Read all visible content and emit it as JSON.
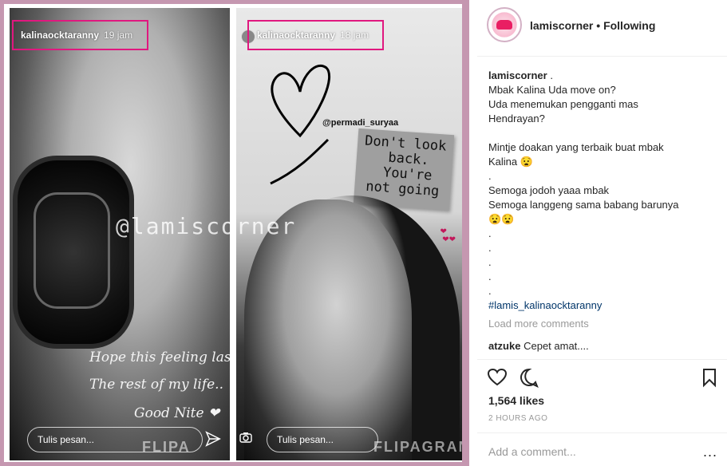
{
  "post": {
    "stories": [
      {
        "username": "kalinaocktaranny",
        "time": "19 jam"
      },
      {
        "username": "kalinaocktaranny",
        "time": "18 jam"
      }
    ],
    "watermark": "@lamiscorner",
    "handwritten_lines": [
      "Hope this feeling lasts",
      "The rest of my life..",
      "Good Nite ❤"
    ],
    "reply_placeholder_left": "Tulis pesan...",
    "reply_placeholder_right": "Tulis pesan...",
    "mention": "@permadi_suryaa",
    "sign_text": "Don't look\n back.\n You're\nnot going",
    "app_watermark_left": "FLIPA",
    "app_watermark_right": "FLIPAGRAN"
  },
  "header": {
    "username": "lamiscorner",
    "separator": "•",
    "follow_state": "Following"
  },
  "caption": {
    "author": "lamiscorner",
    "author_suffix": " .",
    "lines": [
      "Mbak Kalina Uda move on?",
      "Uda menemukan pengganti mas",
      "Hendrayan?",
      "",
      "Mintje doakan yang terbaik buat mbak",
      "Kalina 😧",
      ".",
      "Semoga jodoh yaaa mbak",
      "Semoga langgeng sama babang barunya",
      "😧😧",
      ".",
      ".",
      ".",
      ".",
      "."
    ],
    "hashtag": "#lamis_kalinaocktaranny"
  },
  "comments": {
    "load_more": "Load more comments",
    "items": [
      {
        "user": "atzuke",
        "text": "Cepet amat...."
      }
    ]
  },
  "actions": {
    "like_icon": "heart-icon",
    "comment_icon": "comment-icon",
    "save_icon": "bookmark-icon"
  },
  "likes": "1,564 likes",
  "time_ago": "2 HOURS AGO",
  "add_comment_placeholder": "Add a comment...",
  "more_options": "...",
  "colors": {
    "highlight": "#e0187f",
    "frame": "#c597b0",
    "hashtag": "#003569"
  }
}
